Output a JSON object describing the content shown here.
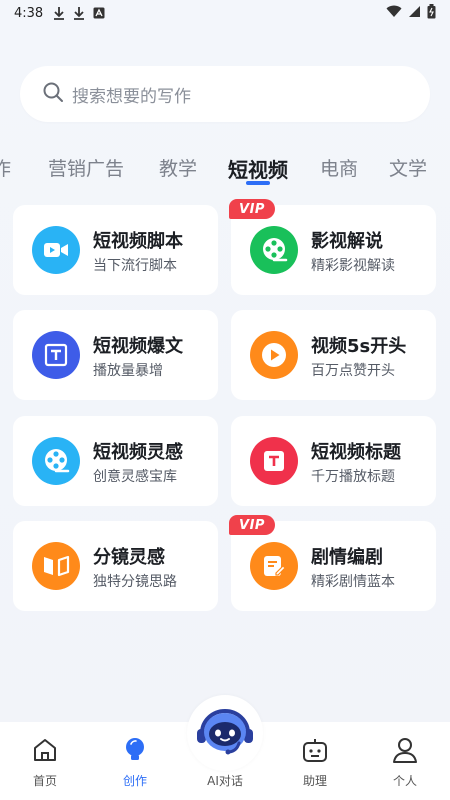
{
  "status_bar": {
    "time": "4:38"
  },
  "search": {
    "placeholder": "搜索想要的写作"
  },
  "tabs": [
    {
      "label": "作"
    },
    {
      "label": "营销广告"
    },
    {
      "label": "教学"
    },
    {
      "label": "短视频"
    },
    {
      "label": "电商"
    },
    {
      "label": "文学"
    }
  ],
  "active_tab": "短视频",
  "vip_badge": "VIP",
  "cards": [
    {
      "title": "短视频脚本",
      "subtitle": "当下流行脚本",
      "icon": "video-camera-icon",
      "color": "#29b3f5",
      "vip": false
    },
    {
      "title": "影视解说",
      "subtitle": "精彩影视解读",
      "icon": "film-reel-icon",
      "color": "#19c05a",
      "vip": true
    },
    {
      "title": "短视频爆文",
      "subtitle": "播放量暴增",
      "icon": "text-document-icon",
      "color": "#3e5ce8",
      "vip": false
    },
    {
      "title": "视频5s开头",
      "subtitle": "百万点赞开头",
      "icon": "play-icon",
      "color": "#ff8a1a",
      "vip": false
    },
    {
      "title": "短视频灵感",
      "subtitle": "创意灵感宝库",
      "icon": "film-reel-icon",
      "color": "#29b3f5",
      "vip": false
    },
    {
      "title": "短视频标题",
      "subtitle": "千万播放标题",
      "icon": "title-t-icon",
      "color": "#f0314b",
      "vip": false
    },
    {
      "title": "分镜灵感",
      "subtitle": "独特分镜思路",
      "icon": "storyboard-icon",
      "color": "#ff8a1a",
      "vip": false
    },
    {
      "title": "剧情编剧",
      "subtitle": "精彩剧情蓝本",
      "icon": "script-edit-icon",
      "color": "#ff8a1a",
      "vip": true
    }
  ],
  "bottom_nav": [
    {
      "label": "首页",
      "icon": "home-icon",
      "active": false
    },
    {
      "label": "创作",
      "icon": "bulb-icon",
      "active": true
    },
    {
      "label": "AI对话",
      "icon": "robot-icon",
      "active": false
    },
    {
      "label": "助理",
      "icon": "assistant-icon",
      "active": false
    },
    {
      "label": "个人",
      "icon": "person-icon",
      "active": false
    }
  ],
  "colors": {
    "accent": "#2d6ef6",
    "vip": "#f0414b"
  }
}
